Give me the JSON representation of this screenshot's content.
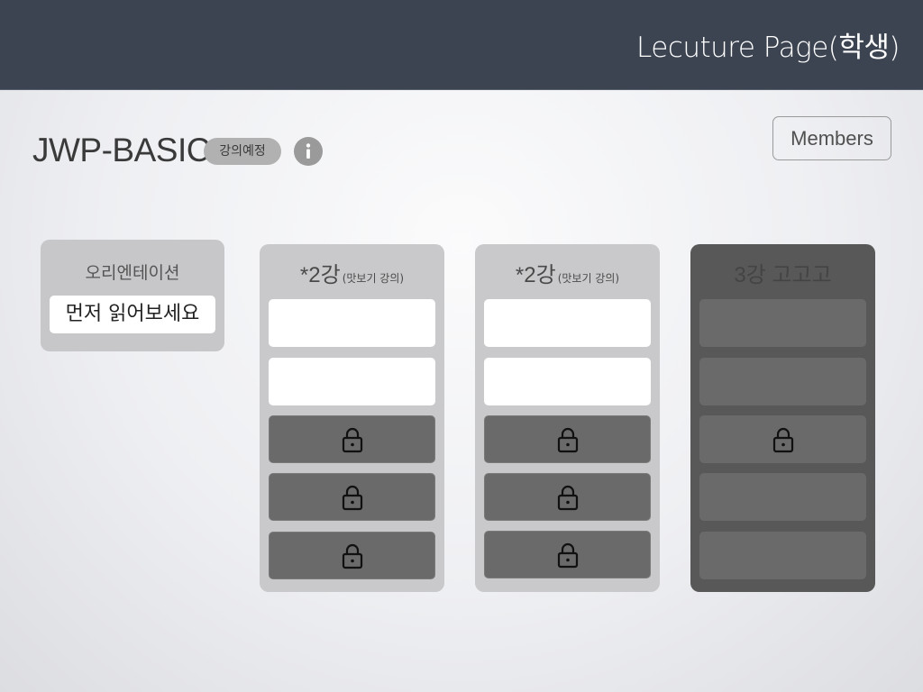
{
  "header": {
    "title": "Lecuture Page(학생)"
  },
  "course": {
    "title": "JWP-BASIC",
    "status_badge": "강의예정",
    "info_icon": "info-icon"
  },
  "members_button": {
    "label": "Members"
  },
  "orientation": {
    "title": "오리엔테이션",
    "link_label": "먼저 읽어보세요"
  },
  "columns": [
    {
      "title": "*2강",
      "subtitle": "(맛보기 강의)",
      "slots": [
        "open",
        "open",
        "locked",
        "locked",
        "locked"
      ]
    },
    {
      "title": "*2강",
      "subtitle": "(맛보기 강의)",
      "slots": [
        "open",
        "open",
        "locked",
        "locked",
        "locked"
      ]
    },
    {
      "title": "3강 고고고",
      "subtitle": "",
      "slots": [
        "empty",
        "empty",
        "locked",
        "empty",
        "empty"
      ]
    }
  ],
  "colors": {
    "header_bg": "#3c4452",
    "card_bg": "#c9c9cb",
    "dark_column_bg": "#585858",
    "locked_slot_bg": "#6a6a6a",
    "open_slot_bg": "#ffffff"
  },
  "icons": {
    "lock": "lock-icon",
    "info": "info-icon"
  }
}
